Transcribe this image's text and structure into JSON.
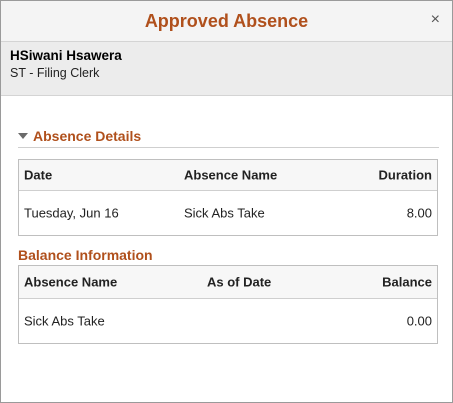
{
  "dialog": {
    "title": "Approved Absence",
    "close_glyph": "×",
    "close_icon": "close-icon"
  },
  "employee": {
    "name": "HSiwani Hsawera",
    "job_title": "ST - Filing Clerk"
  },
  "absence_details": {
    "heading": "Absence Details",
    "toggle_icon": "triangle-down-icon",
    "columns": {
      "date": "Date",
      "absence_name": "Absence Name",
      "duration": "Duration"
    },
    "rows": [
      {
        "date": "Tuesday, Jun 16",
        "absence_name": "Sick Abs Take",
        "duration": "8.00"
      }
    ]
  },
  "balance_information": {
    "heading": "Balance Information",
    "columns": {
      "absence_name": "Absence Name",
      "as_of_date": "As of Date",
      "balance": "Balance"
    },
    "rows": [
      {
        "absence_name": "Sick Abs Take",
        "as_of_date": "",
        "balance": "0.00"
      }
    ]
  },
  "colors": {
    "accent": "#b0501c",
    "header_bg": "#f4f4f4",
    "employee_bg": "#ececec"
  }
}
